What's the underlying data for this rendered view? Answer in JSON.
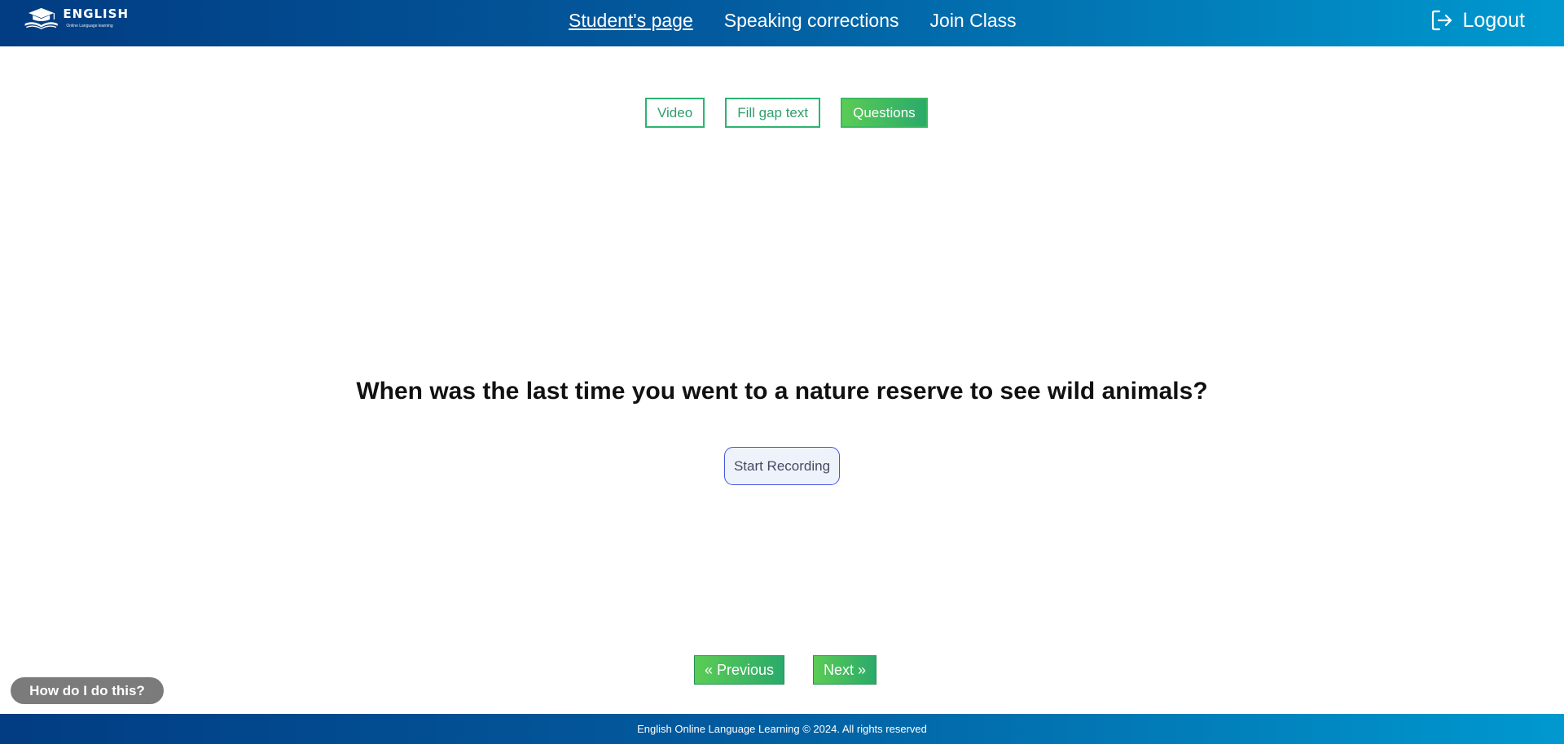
{
  "brand": {
    "title": "ENGLISH",
    "subtitle": "Online Language learning"
  },
  "nav": {
    "items": [
      {
        "label": "Student's page",
        "active": true
      },
      {
        "label": "Speaking corrections",
        "active": false
      },
      {
        "label": "Join Class",
        "active": false
      }
    ]
  },
  "header": {
    "logout_label": "Logout",
    "logout_icon": "logout-icon"
  },
  "tabs": [
    {
      "label": "Video",
      "active": false
    },
    {
      "label": "Fill gap text",
      "active": false
    },
    {
      "label": "Questions",
      "active": true
    }
  ],
  "main": {
    "question": "When was the last time you went to a nature reserve to see wild animals?",
    "record_label": "Start Recording"
  },
  "pager": {
    "previous_label": "« Previous",
    "next_label": "Next »"
  },
  "help": {
    "label": "How do I do this?"
  },
  "footer": {
    "text": "English Online Language Learning © 2024. All rights reserved"
  },
  "colors": {
    "header_gradient_start": "#023c82",
    "header_gradient_end": "#0099cf",
    "accent_green": "#2bb56f",
    "help_gray": "#7b7b7b"
  }
}
